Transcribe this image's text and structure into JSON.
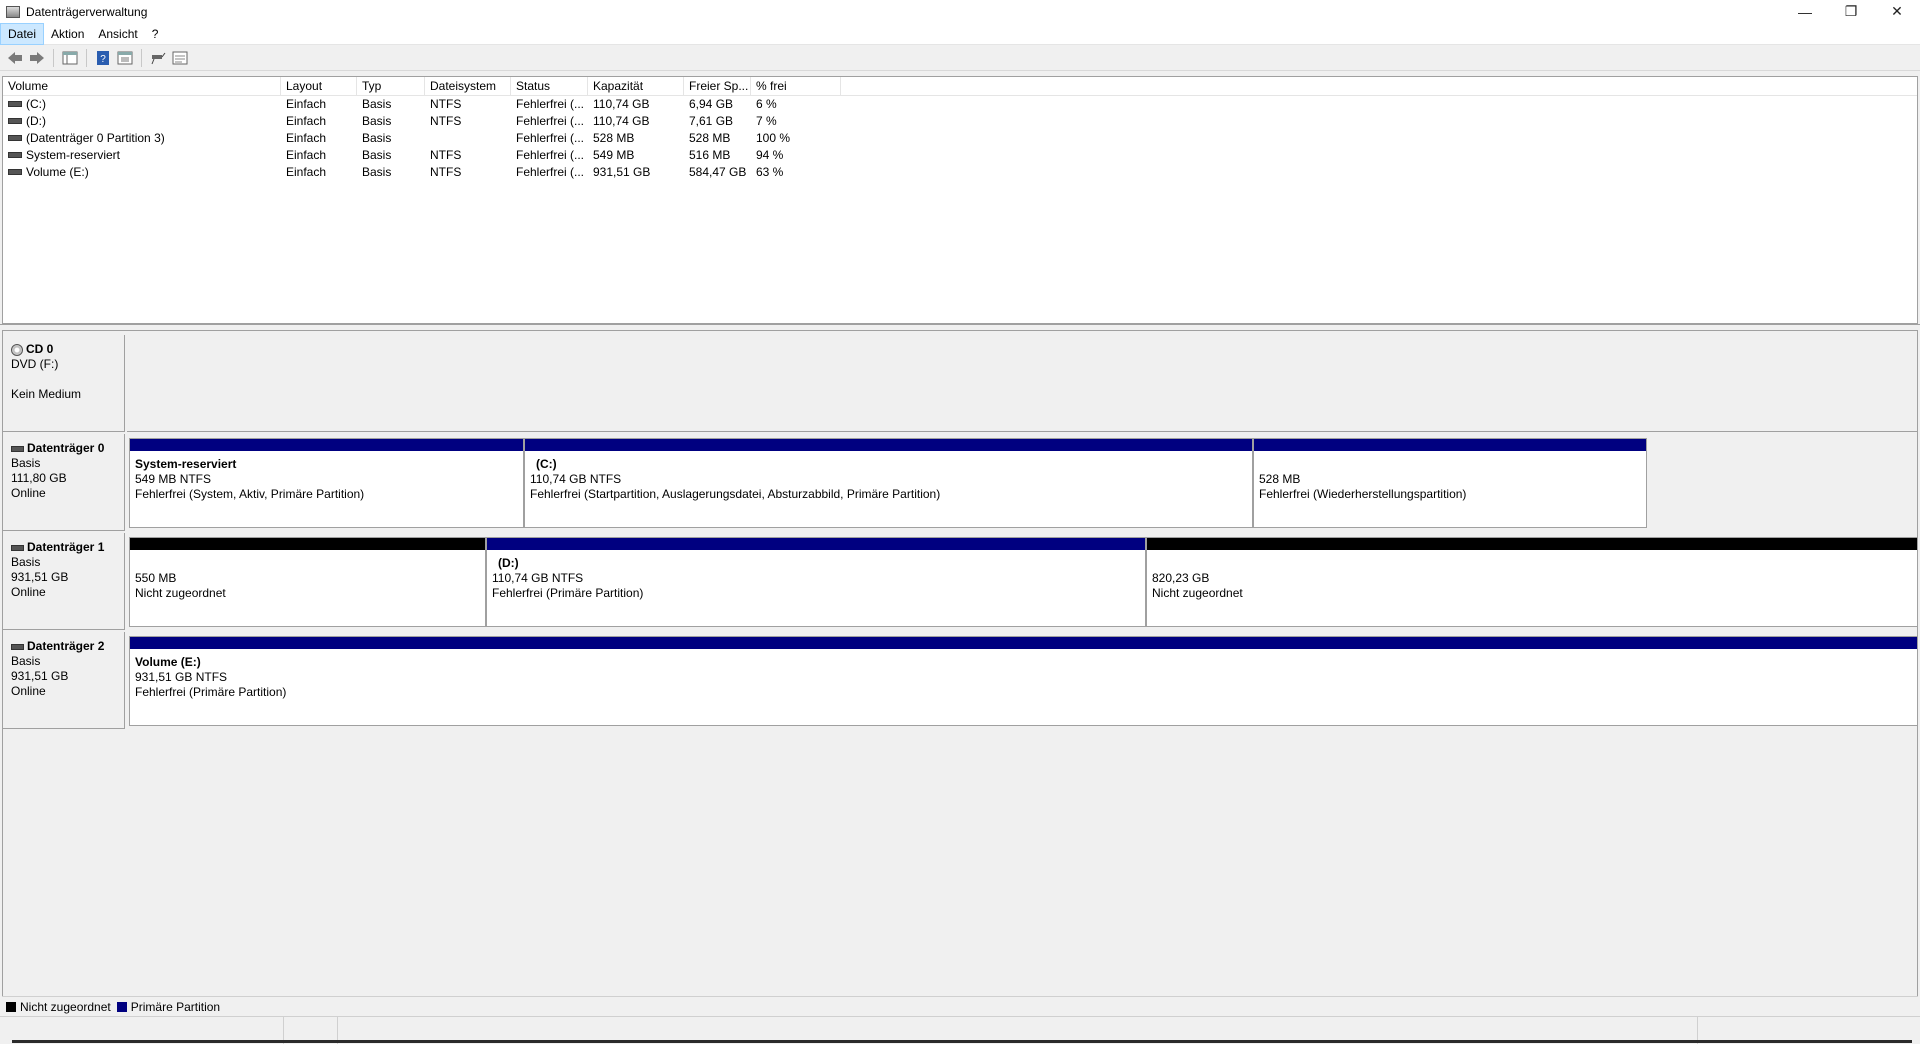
{
  "window": {
    "title": "Datenträgerverwaltung",
    "minimize": "—",
    "restore": "❐",
    "close": "✕"
  },
  "menu": {
    "items": [
      "Datei",
      "Aktion",
      "Ansicht",
      "?"
    ]
  },
  "volume_list": {
    "columns": [
      "Volume",
      "Layout",
      "Typ",
      "Dateisystem",
      "Status",
      "Kapazität",
      "Freier Sp...",
      "% frei"
    ],
    "rows": [
      {
        "volume": "(C:)",
        "layout": "Einfach",
        "typ": "Basis",
        "fs": "NTFS",
        "status": "Fehlerfrei (...",
        "capacity": "110,74 GB",
        "free": "6,94 GB",
        "pct": "6 %"
      },
      {
        "volume": "(D:)",
        "layout": "Einfach",
        "typ": "Basis",
        "fs": "NTFS",
        "status": "Fehlerfrei (...",
        "capacity": "110,74 GB",
        "free": "7,61 GB",
        "pct": "7 %"
      },
      {
        "volume": "(Datenträger 0 Partition 3)",
        "layout": "Einfach",
        "typ": "Basis",
        "fs": "",
        "status": "Fehlerfrei (...",
        "capacity": "528 MB",
        "free": "528 MB",
        "pct": "100 %"
      },
      {
        "volume": "System-reserviert",
        "layout": "Einfach",
        "typ": "Basis",
        "fs": "NTFS",
        "status": "Fehlerfrei (...",
        "capacity": "549 MB",
        "free": "516 MB",
        "pct": "94 %"
      },
      {
        "volume": "Volume (E:)",
        "layout": "Einfach",
        "typ": "Basis",
        "fs": "NTFS",
        "status": "Fehlerfrei (...",
        "capacity": "931,51 GB",
        "free": "584,47 GB",
        "pct": "63 %"
      }
    ]
  },
  "disks": {
    "cd0": {
      "title": "CD 0",
      "line1": "DVD (F:)",
      "line2": "Kein Medium"
    },
    "disk0": {
      "title": "Datenträger 0",
      "type": "Basis",
      "size": "111,80 GB",
      "state": "Online",
      "partitions": [
        {
          "name": "System-reserviert",
          "size": "549 MB NTFS",
          "status": "Fehlerfrei (System, Aktiv, Primäre Partition)"
        },
        {
          "name": "(C:)",
          "size": "110,74 GB NTFS",
          "status": "Fehlerfrei (Startpartition, Auslagerungsdatei, Absturzabbild, Primäre Partition)"
        },
        {
          "name": "",
          "size": "528 MB",
          "status": "Fehlerfrei (Wiederherstellungspartition)"
        }
      ]
    },
    "disk1": {
      "title": "Datenträger 1",
      "type": "Basis",
      "size": "931,51 GB",
      "state": "Online",
      "partitions": [
        {
          "name": "",
          "size": "550 MB",
          "status": "Nicht zugeordnet"
        },
        {
          "name": "(D:)",
          "size": "110,74 GB NTFS",
          "status": "Fehlerfrei (Primäre Partition)"
        },
        {
          "name": "",
          "size": "820,23 GB",
          "status": "Nicht zugeordnet"
        }
      ]
    },
    "disk2": {
      "title": "Datenträger 2",
      "type": "Basis",
      "size": "931,51 GB",
      "state": "Online",
      "partitions": [
        {
          "name": "Volume  (E:)",
          "size": "931,51 GB NTFS",
          "status": "Fehlerfrei (Primäre Partition)"
        }
      ]
    }
  },
  "legend": {
    "unallocated": "Nicht zugeordnet",
    "primary": "Primäre Partition"
  },
  "colors": {
    "primary": "#000080",
    "unallocated": "#000000"
  }
}
